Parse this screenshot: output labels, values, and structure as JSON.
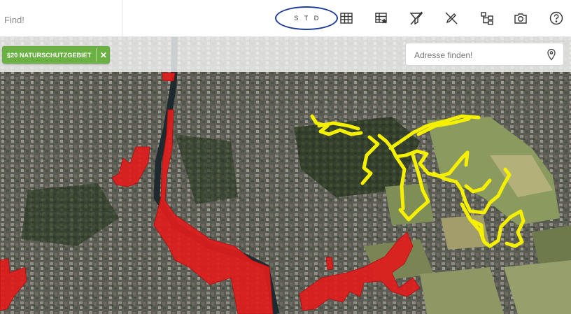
{
  "search": {
    "placeholder": "Find!"
  },
  "map_style": {
    "options": [
      "S",
      "T",
      "D"
    ]
  },
  "toolbar": {
    "tools": [
      {
        "name": "table-icon"
      },
      {
        "name": "table-star-icon"
      },
      {
        "name": "filter-clear-icon"
      },
      {
        "name": "draw-clear-icon"
      },
      {
        "name": "tree-icon"
      },
      {
        "name": "camera-icon"
      },
      {
        "name": "help-icon"
      }
    ]
  },
  "filter_chip": {
    "label": "§20 NATURSCHUTZGEBIET",
    "close": "✕",
    "color": "#6ab043"
  },
  "address": {
    "placeholder": "Adresse finden!"
  },
  "layers": {
    "protected_area_color": "#e01c1c",
    "selection_color": "#f5f000"
  }
}
